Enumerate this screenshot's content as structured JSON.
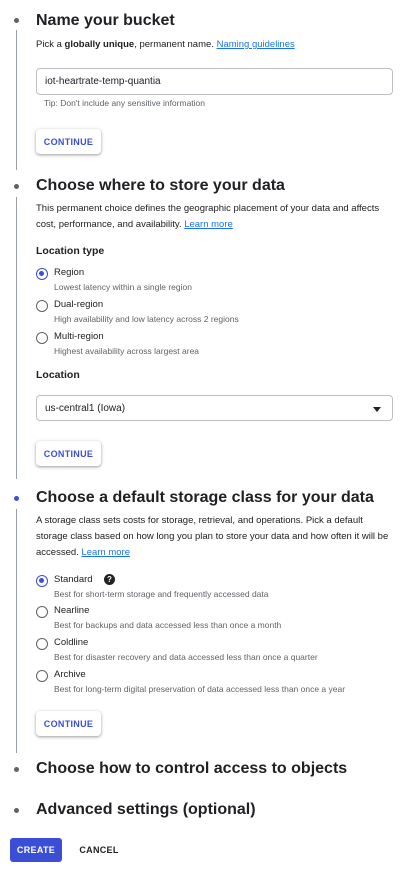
{
  "step1": {
    "title": "Name your bucket",
    "desc_prefix": "Pick a ",
    "desc_bold": "globally unique",
    "desc_suffix": ", permanent name. ",
    "desc_link": "Naming guidelines",
    "input_value": "iot-heartrate-temp-quantia",
    "hint": "Tip: Don't include any sensitive information",
    "continue_label": "CONTINUE"
  },
  "step2": {
    "title": "Choose where to store your data",
    "desc": "This permanent choice defines the geographic placement of your data and affects cost, performance, and availability. ",
    "desc_link": "Learn more",
    "location_type_label": "Location type",
    "options": [
      {
        "label": "Region",
        "desc": "Lowest latency within a single region",
        "checked": true
      },
      {
        "label": "Dual-region",
        "desc": "High availability and low latency across 2 regions",
        "checked": false
      },
      {
        "label": "Multi-region",
        "desc": "Highest availability across largest area",
        "checked": false
      }
    ],
    "location_label": "Location",
    "location_value": "us-central1 (Iowa)",
    "continue_label": "CONTINUE"
  },
  "step3": {
    "title": "Choose a default storage class for your data",
    "desc": "A storage class sets costs for storage, retrieval, and operations. Pick a default storage class based on how long you plan to store your data and how often it will be accessed. ",
    "desc_link": "Learn more",
    "options": [
      {
        "label": "Standard",
        "desc": "Best for short-term storage and frequently accessed data",
        "checked": true
      },
      {
        "label": "Nearline",
        "desc": "Best for backups and data accessed less than once a month",
        "checked": false
      },
      {
        "label": "Coldline",
        "desc": "Best for disaster recovery and data accessed less than once a quarter",
        "checked": false
      },
      {
        "label": "Archive",
        "desc": "Best for long-term digital preservation of data accessed less than once a year",
        "checked": false
      }
    ],
    "help_icon": "help-icon",
    "help_glyph": "?",
    "continue_label": "CONTINUE"
  },
  "step4": {
    "title": "Choose how to control access to objects"
  },
  "step5": {
    "title": "Advanced settings (optional)"
  },
  "footer": {
    "create_label": "CREATE",
    "cancel_label": "CANCEL"
  },
  "colors": {
    "accent": "#3b4fd6",
    "link": "#1a73e8",
    "rail": "#9aa0a6"
  }
}
